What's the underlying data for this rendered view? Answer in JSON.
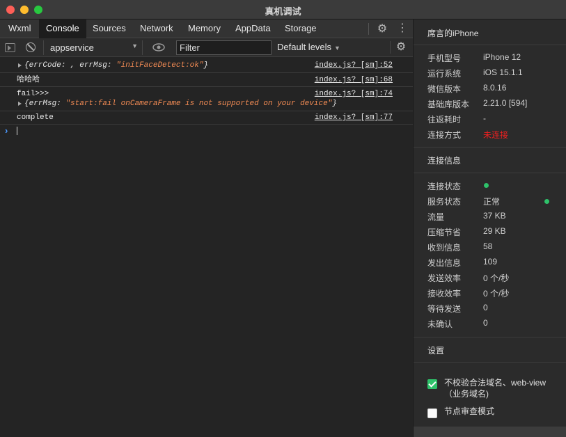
{
  "window": {
    "title": "真机调试"
  },
  "tabs": [
    {
      "label": "Wxml",
      "active": false
    },
    {
      "label": "Console",
      "active": true
    },
    {
      "label": "Sources",
      "active": false
    },
    {
      "label": "Network",
      "active": false
    },
    {
      "label": "Memory",
      "active": false
    },
    {
      "label": "AppData",
      "active": false
    },
    {
      "label": "Storage",
      "active": false
    }
  ],
  "toolbar": {
    "context": "appservice",
    "filter_placeholder": "Filter",
    "levels": "Default levels"
  },
  "console": {
    "logs": [
      {
        "parts": [
          "{",
          "errCode: ",
          ", errMsg: ",
          "\"initFaceDetect:ok\"",
          "}"
        ],
        "source": "index.js? [sm]:52"
      },
      {
        "text": "哈哈哈",
        "source": "index.js? [sm]:68"
      },
      {
        "text": "fail>>>",
        "parts": [
          "{",
          "errMsg: ",
          "\"start:fail onCameraFrame is not supported on your device\"",
          "}"
        ],
        "source": "index.js? [sm]:74"
      },
      {
        "text": "complete",
        "source": "index.js? [sm]:77"
      }
    ]
  },
  "device": {
    "name": "席言的iPhone",
    "rows": [
      {
        "label": "手机型号",
        "value": "iPhone 12"
      },
      {
        "label": "运行系统",
        "value": "iOS 15.1.1"
      },
      {
        "label": "微信版本",
        "value": "8.0.16"
      },
      {
        "label": "基础库版本",
        "value": "2.21.0 [594]"
      },
      {
        "label": "往返耗时",
        "value": "-"
      },
      {
        "label": "连接方式",
        "value": "未连接"
      }
    ]
  },
  "connection": {
    "title": "连接信息",
    "rows": [
      {
        "label": "连接状态",
        "value": ""
      },
      {
        "label": "服务状态",
        "value": "正常"
      },
      {
        "label": "流量",
        "value": "37 KB"
      },
      {
        "label": "压缩节省",
        "value": "29 KB"
      },
      {
        "label": "收到信息",
        "value": "58"
      },
      {
        "label": "发出信息",
        "value": "109"
      },
      {
        "label": "发送效率",
        "value": "0 个/秒"
      },
      {
        "label": "接收效率",
        "value": "0 个/秒"
      },
      {
        "label": "等待发送",
        "value": "0"
      },
      {
        "label": "未确认",
        "value": "0"
      }
    ],
    "status_color": "#2ec26a"
  },
  "settings": {
    "title": "设置",
    "options": [
      {
        "label": "不校验合法域名、web-view（业务域名)",
        "checked": true
      },
      {
        "label": "节点审查模式",
        "checked": false
      }
    ]
  },
  "colors": {
    "accent": "#2ec26a",
    "error": "#f02020",
    "string": "#f28b54",
    "prompt": "#4c9aff"
  }
}
